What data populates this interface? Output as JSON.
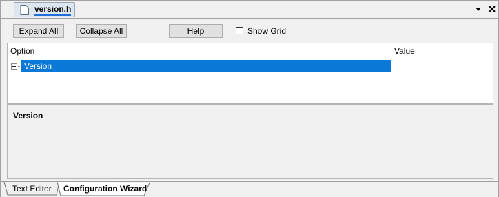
{
  "document_tab": {
    "title": "version.h",
    "icon": "document-icon"
  },
  "window_controls": {
    "menu_icon": "dropdown-arrow-icon",
    "close_icon": "close-icon"
  },
  "toolbar": {
    "expand_all": "Expand All",
    "collapse_all": "Collapse All",
    "help": "Help",
    "show_grid": {
      "label": "Show Grid",
      "checked": false
    }
  },
  "grid": {
    "columns": [
      "Option",
      "Value"
    ],
    "rows": [
      {
        "label": "Version",
        "value": "",
        "selected": true,
        "expanded": false
      }
    ]
  },
  "description": {
    "title": "Version"
  },
  "bottom_tabs": [
    {
      "label": "Text Editor",
      "active": false
    },
    {
      "label": "Configuration Wizard",
      "active": true
    }
  ],
  "colors": {
    "selection": "#0a78d7",
    "tab_underline": "#1e6fd9",
    "tab_fill": "#dde6ef"
  }
}
